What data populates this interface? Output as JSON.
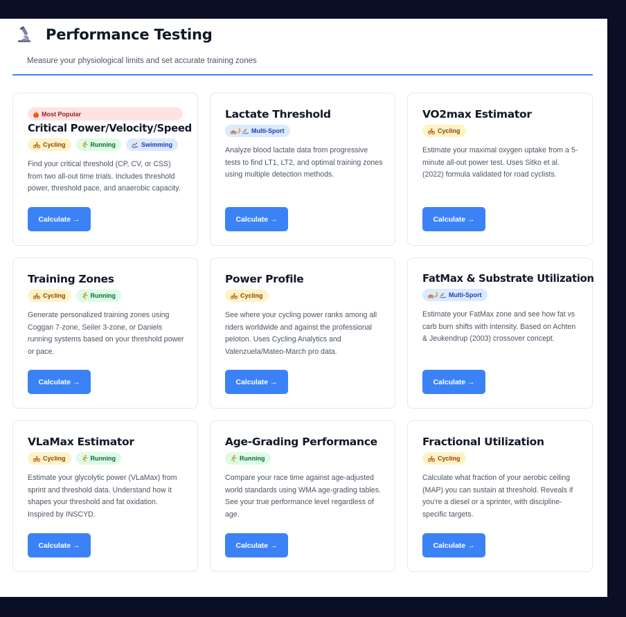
{
  "header": {
    "title": "Performance Testing",
    "subtitle": "Measure your physiological limits and set accurate training zones",
    "icon": "microscope-icon"
  },
  "cards": [
    {
      "badge": "Most Popular",
      "title": "Critical Power/Velocity/Speed",
      "tags": [
        "Cycling",
        "Running",
        "Swimming"
      ],
      "description": "Find your critical threshold (CP, CV, or CSS) from two all-out time trials. Includes threshold power, threshold pace, and anaerobic capacity.",
      "button": "Calculate →"
    },
    {
      "title": "Lactate Threshold",
      "tags": [
        "Multi-Sport"
      ],
      "description": "Analyze blood lactate data from progressive tests to find LT1, LT2, and optimal training zones using multiple detection methods.",
      "button": "Calculate →"
    },
    {
      "title": "VO2max Estimator",
      "tags": [
        "Cycling"
      ],
      "description": "Estimate your maximal oxygen uptake from a 5-minute all-out power test. Uses Sitko et al. (2022) formula validated for road cyclists.",
      "button": "Calculate →"
    },
    {
      "title": "Training Zones",
      "tags": [
        "Cycling",
        "Running"
      ],
      "description": "Generate personalized training zones using Coggan 7-zone, Seiler 3-zone, or Daniels running systems based on your threshold power or pace.",
      "button": "Calculate →"
    },
    {
      "title": "Power Profile",
      "tags": [
        "Cycling"
      ],
      "description": "See where your cycling power ranks among all riders worldwide and against the professional peloton. Uses Cycling Analytics and Valenzuela/Mateo-March pro data.",
      "button": "Calculate →"
    },
    {
      "title": "FatMax & Substrate Utilization",
      "tags": [
        "Multi-Sport"
      ],
      "description": "Estimate your FatMax zone and see how fat vs carb burn shifts with intensity. Based on Achten & Jeukendrup (2003) crossover concept.",
      "button": "Calculate →"
    },
    {
      "title": "VLaMax Estimator",
      "tags": [
        "Cycling",
        "Running"
      ],
      "description": "Estimate your glycolytic power (VLaMax) from sprint and threshold data. Understand how it shapes your threshold and fat oxidation. Inspired by INSCYD.",
      "button": "Calculate →"
    },
    {
      "title": "Age-Grading Performance",
      "tags": [
        "Running"
      ],
      "description": "Compare your race time against age-adjusted world standards using WMA age-grading tables. See your true performance level regardless of age.",
      "button": "Calculate →"
    },
    {
      "title": "Fractional Utilization",
      "tags": [
        "Cycling"
      ],
      "description": "Calculate what fraction of your aerobic ceiling (MAP) you can sustain at threshold. Reveals if you're a diesel or a sprinter, with discipline-specific targets.",
      "button": "Calculate →"
    }
  ],
  "colors": {
    "background": "#0a0e27",
    "accent": "#3b82f6",
    "cycling_tag": "#fef3c7",
    "running_tag": "#dcfce7",
    "swimming_tag": "#dbeafe",
    "popular_badge": "#fee2e2"
  }
}
